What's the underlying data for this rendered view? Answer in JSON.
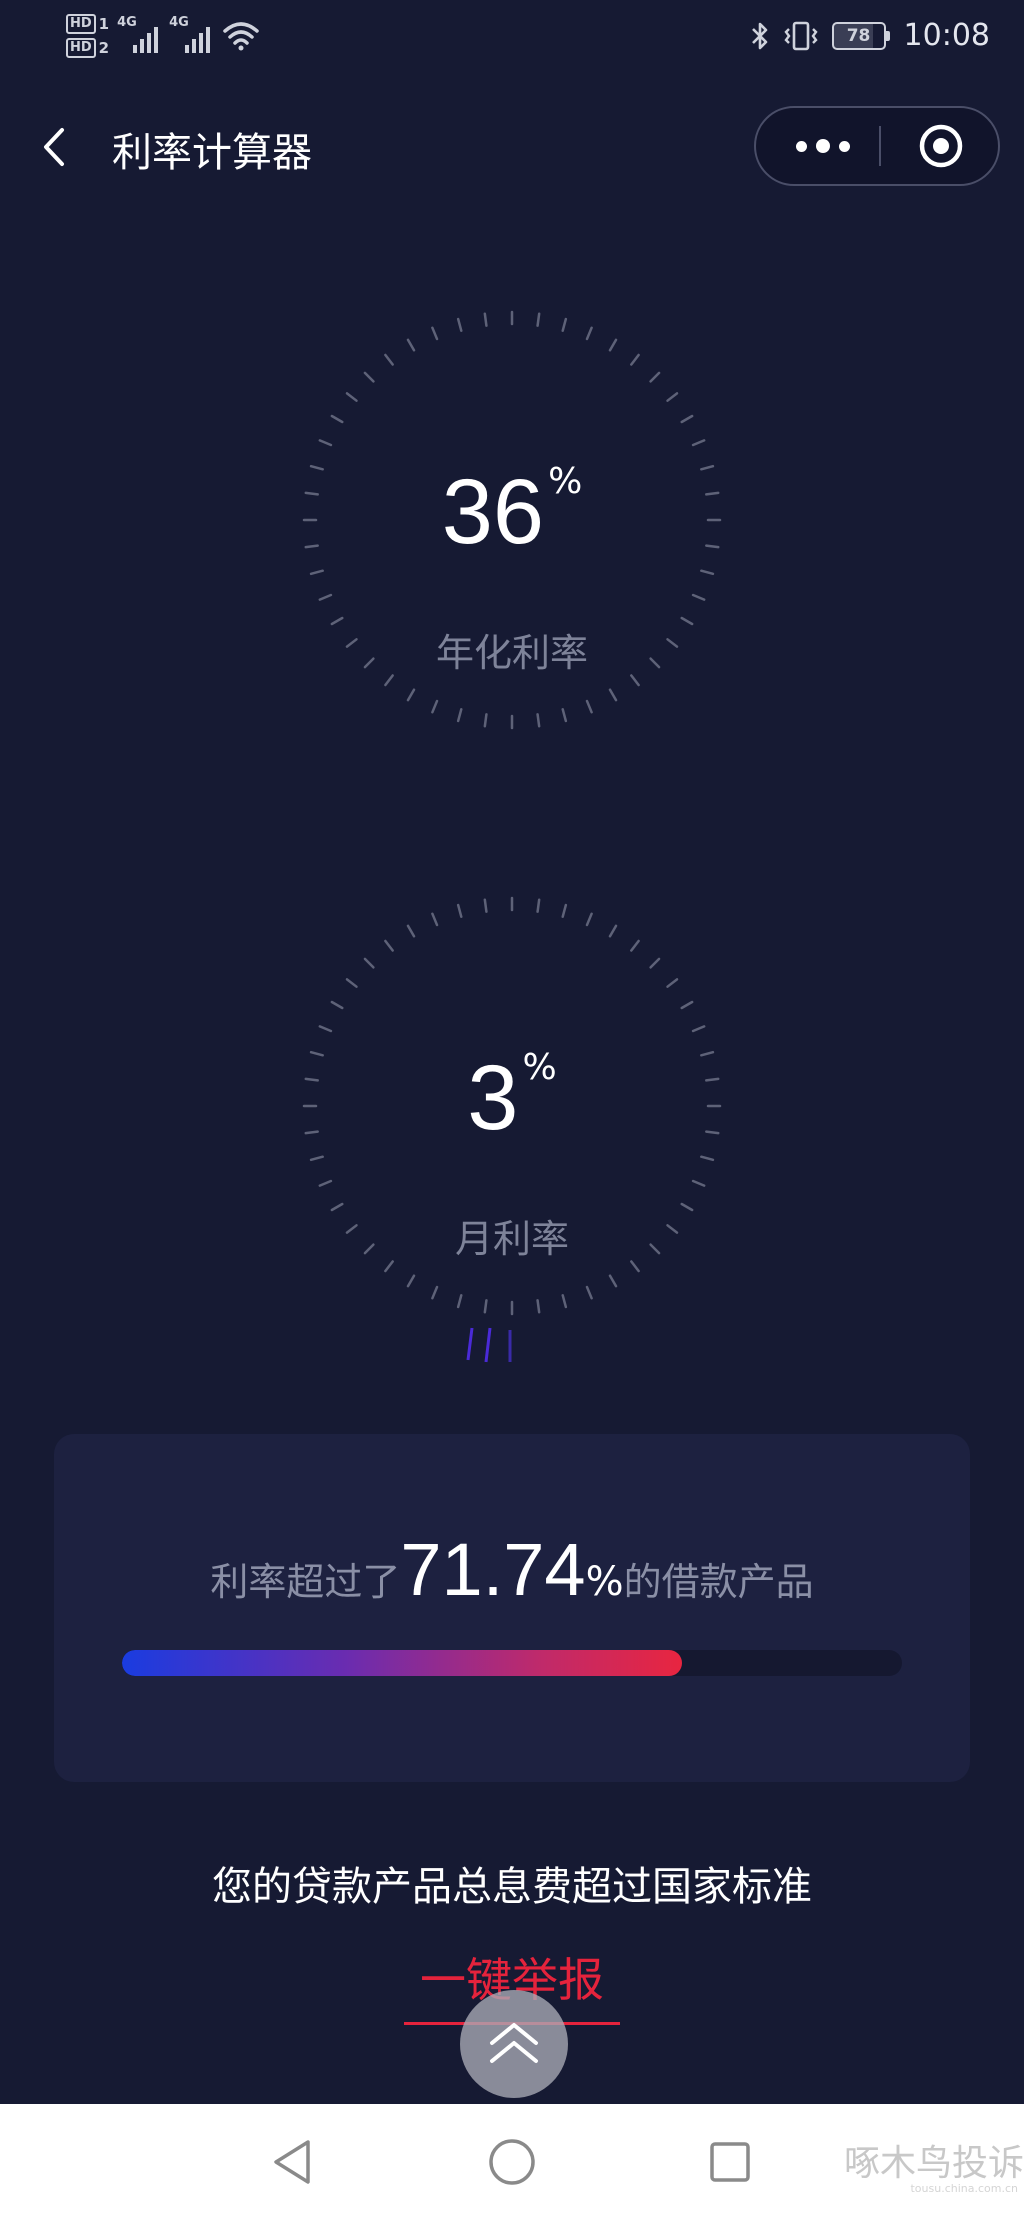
{
  "status_bar": {
    "hd1": "HD",
    "hd1_sub": "1",
    "hd2": "HD",
    "hd2_sub": "2",
    "net1": "4G",
    "net2": "4G",
    "battery": "78",
    "time": "10:08",
    "icons": [
      "signal-icon",
      "wifi-icon",
      "bluetooth-icon",
      "vibrate-icon",
      "battery-icon"
    ]
  },
  "nav": {
    "title": "利率计算器",
    "back_icon": "chevron-left-icon",
    "more_icon": "more-dots-icon",
    "close_icon": "target-circle-icon"
  },
  "annual_rate": {
    "value": "36",
    "unit": "%",
    "label": "年化利率"
  },
  "monthly_rate": {
    "value": "3",
    "unit": "%",
    "label": "月利率"
  },
  "stat": {
    "prefix": "利率超过了",
    "value": "71.74",
    "unit": "%",
    "suffix": "的借款产品",
    "progress_fraction": 0.7174
  },
  "warning_text": "您的贷款产品总息费超过国家标准",
  "report_link": "一键举报",
  "colors": {
    "background": "#161a33",
    "card": "#1d2140",
    "accent_red": "#e5233c",
    "accent_blue": "#1a3ce0",
    "muted_text": "#7e8399"
  },
  "system_nav": {
    "icons": [
      "back-triangle-icon",
      "home-circle-icon",
      "recents-square-icon"
    ]
  },
  "watermark": {
    "text": "啄木鸟投诉",
    "sub": "tousu.china.com.cn"
  }
}
